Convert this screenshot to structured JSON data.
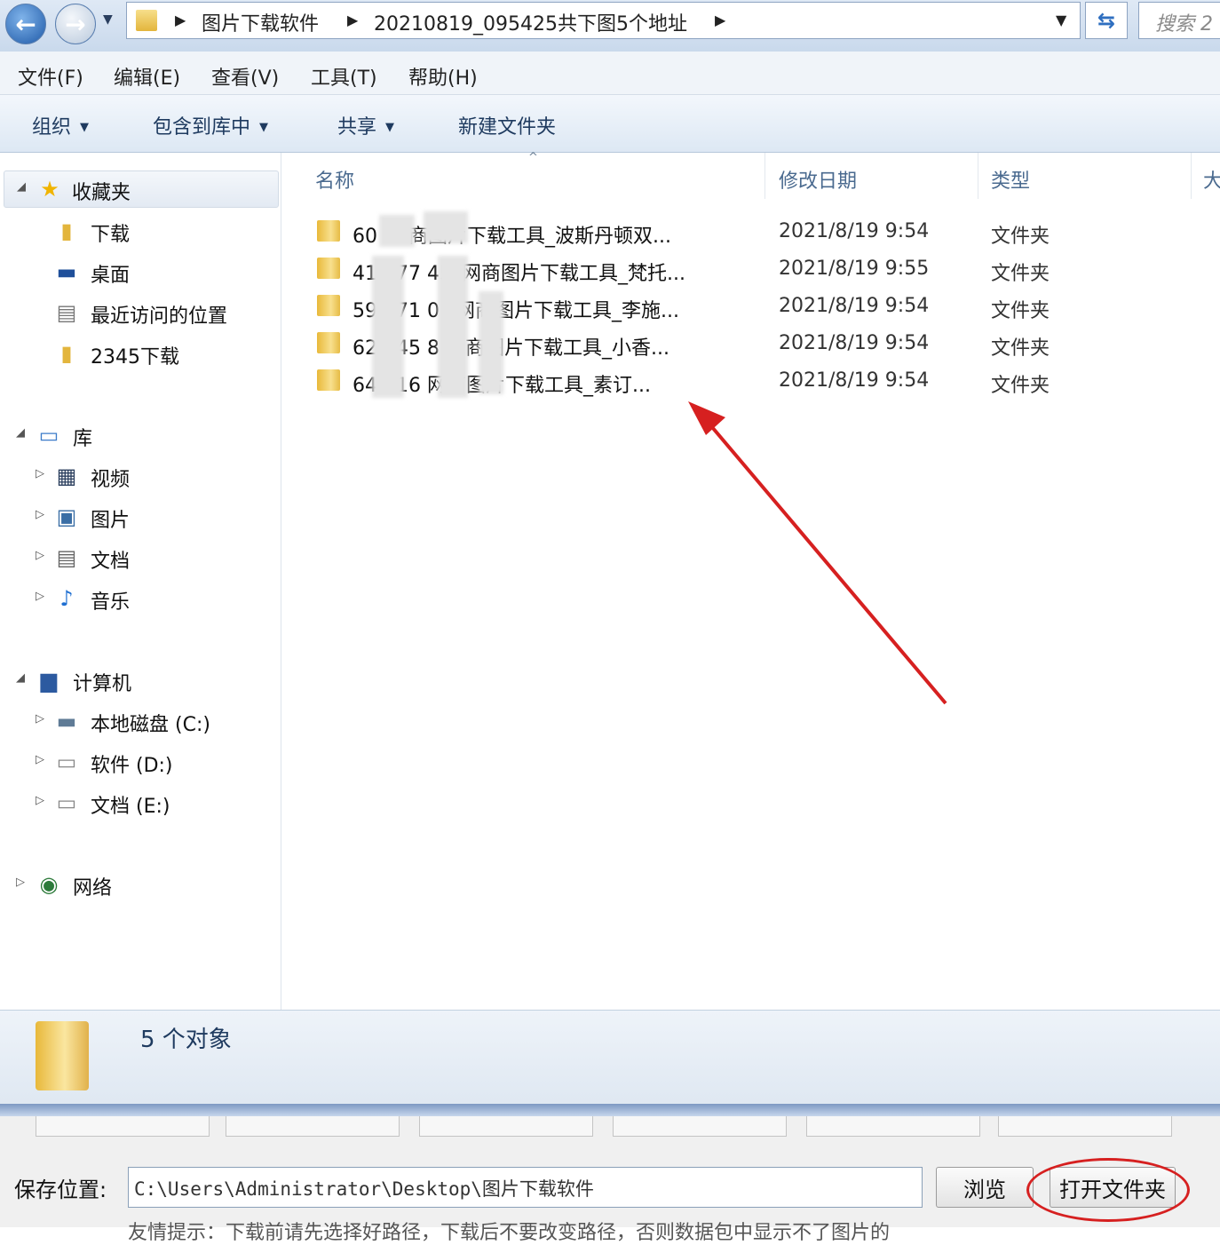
{
  "address_bar": {
    "crumbs": [
      "图片下载软件",
      "20210819_095425共下图5个地址"
    ],
    "search_placeholder": "搜索 2"
  },
  "menu": [
    "文件(F)",
    "编辑(E)",
    "查看(V)",
    "工具(T)",
    "帮助(H)"
  ],
  "toolbar": {
    "organize": "组织",
    "include_in_library": "包含到库中",
    "share": "共享",
    "new_folder": "新建文件夹"
  },
  "nav": {
    "favorites": {
      "label": "收藏夹",
      "items": [
        "下载",
        "桌面",
        "最近访问的位置",
        "2345下载"
      ]
    },
    "library": {
      "label": "库",
      "items": [
        "视频",
        "图片",
        "文档",
        "音乐"
      ]
    },
    "computer": {
      "label": "计算机",
      "items": [
        "本地磁盘 (C:)",
        "软件 (D:)",
        "文档 (E:)"
      ]
    },
    "network": {
      "label": "网络"
    }
  },
  "columns": {
    "name": "名称",
    "date": "修改日期",
    "type": "类型",
    "size": "大"
  },
  "files": [
    {
      "name": "60  0.   商图片下载工具_波斯丹顿双...",
      "date": "2021/8/19 9:54",
      "type": "文件夹"
    },
    {
      "name": "41  877  45_网商图片下载工具_梵托...",
      "date": "2021/8/19 9:55",
      "type": "文件夹"
    },
    {
      "name": "59  471  0  _网商图片下载工具_李施...",
      "date": "2021/8/19 9:54",
      "type": "文件夹"
    },
    {
      "name": "62  745  8  网商图片下载工具_小香...",
      "date": "2021/8/19 9:54",
      "type": "文件夹"
    },
    {
      "name": "648    16  网商图片下载工具_素订...",
      "date": "2021/8/19 9:54",
      "type": "文件夹"
    }
  ],
  "details": {
    "count_text": "5 个对象"
  },
  "app": {
    "save_label": "保存位置:",
    "save_path": "C:\\Users\\Administrator\\Desktop\\图片下载软件",
    "browse_button": "浏览",
    "open_folder_button": "打开文件夹",
    "hint_text": "友情提示：下载前请先选择好路径，下载后不要改变路径，否则数据包中显示不了图片的"
  },
  "colors": {
    "annotation_red": "#d62020",
    "accent_blue": "#2f6fc0"
  }
}
